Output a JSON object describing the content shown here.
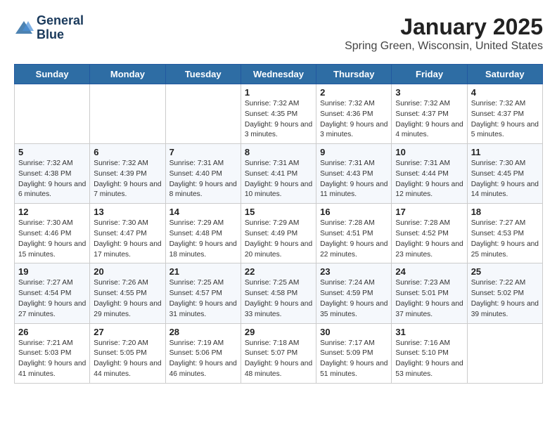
{
  "header": {
    "logo_line1": "General",
    "logo_line2": "Blue",
    "month_title": "January 2025",
    "location": "Spring Green, Wisconsin, United States"
  },
  "days_of_week": [
    "Sunday",
    "Monday",
    "Tuesday",
    "Wednesday",
    "Thursday",
    "Friday",
    "Saturday"
  ],
  "weeks": [
    [
      {
        "day": "",
        "text": ""
      },
      {
        "day": "",
        "text": ""
      },
      {
        "day": "",
        "text": ""
      },
      {
        "day": "1",
        "text": "Sunrise: 7:32 AM\nSunset: 4:35 PM\nDaylight: 9 hours and 3 minutes."
      },
      {
        "day": "2",
        "text": "Sunrise: 7:32 AM\nSunset: 4:36 PM\nDaylight: 9 hours and 3 minutes."
      },
      {
        "day": "3",
        "text": "Sunrise: 7:32 AM\nSunset: 4:37 PM\nDaylight: 9 hours and 4 minutes."
      },
      {
        "day": "4",
        "text": "Sunrise: 7:32 AM\nSunset: 4:37 PM\nDaylight: 9 hours and 5 minutes."
      }
    ],
    [
      {
        "day": "5",
        "text": "Sunrise: 7:32 AM\nSunset: 4:38 PM\nDaylight: 9 hours and 6 minutes."
      },
      {
        "day": "6",
        "text": "Sunrise: 7:32 AM\nSunset: 4:39 PM\nDaylight: 9 hours and 7 minutes."
      },
      {
        "day": "7",
        "text": "Sunrise: 7:31 AM\nSunset: 4:40 PM\nDaylight: 9 hours and 8 minutes."
      },
      {
        "day": "8",
        "text": "Sunrise: 7:31 AM\nSunset: 4:41 PM\nDaylight: 9 hours and 10 minutes."
      },
      {
        "day": "9",
        "text": "Sunrise: 7:31 AM\nSunset: 4:43 PM\nDaylight: 9 hours and 11 minutes."
      },
      {
        "day": "10",
        "text": "Sunrise: 7:31 AM\nSunset: 4:44 PM\nDaylight: 9 hours and 12 minutes."
      },
      {
        "day": "11",
        "text": "Sunrise: 7:30 AM\nSunset: 4:45 PM\nDaylight: 9 hours and 14 minutes."
      }
    ],
    [
      {
        "day": "12",
        "text": "Sunrise: 7:30 AM\nSunset: 4:46 PM\nDaylight: 9 hours and 15 minutes."
      },
      {
        "day": "13",
        "text": "Sunrise: 7:30 AM\nSunset: 4:47 PM\nDaylight: 9 hours and 17 minutes."
      },
      {
        "day": "14",
        "text": "Sunrise: 7:29 AM\nSunset: 4:48 PM\nDaylight: 9 hours and 18 minutes."
      },
      {
        "day": "15",
        "text": "Sunrise: 7:29 AM\nSunset: 4:49 PM\nDaylight: 9 hours and 20 minutes."
      },
      {
        "day": "16",
        "text": "Sunrise: 7:28 AM\nSunset: 4:51 PM\nDaylight: 9 hours and 22 minutes."
      },
      {
        "day": "17",
        "text": "Sunrise: 7:28 AM\nSunset: 4:52 PM\nDaylight: 9 hours and 23 minutes."
      },
      {
        "day": "18",
        "text": "Sunrise: 7:27 AM\nSunset: 4:53 PM\nDaylight: 9 hours and 25 minutes."
      }
    ],
    [
      {
        "day": "19",
        "text": "Sunrise: 7:27 AM\nSunset: 4:54 PM\nDaylight: 9 hours and 27 minutes."
      },
      {
        "day": "20",
        "text": "Sunrise: 7:26 AM\nSunset: 4:55 PM\nDaylight: 9 hours and 29 minutes."
      },
      {
        "day": "21",
        "text": "Sunrise: 7:25 AM\nSunset: 4:57 PM\nDaylight: 9 hours and 31 minutes."
      },
      {
        "day": "22",
        "text": "Sunrise: 7:25 AM\nSunset: 4:58 PM\nDaylight: 9 hours and 33 minutes."
      },
      {
        "day": "23",
        "text": "Sunrise: 7:24 AM\nSunset: 4:59 PM\nDaylight: 9 hours and 35 minutes."
      },
      {
        "day": "24",
        "text": "Sunrise: 7:23 AM\nSunset: 5:01 PM\nDaylight: 9 hours and 37 minutes."
      },
      {
        "day": "25",
        "text": "Sunrise: 7:22 AM\nSunset: 5:02 PM\nDaylight: 9 hours and 39 minutes."
      }
    ],
    [
      {
        "day": "26",
        "text": "Sunrise: 7:21 AM\nSunset: 5:03 PM\nDaylight: 9 hours and 41 minutes."
      },
      {
        "day": "27",
        "text": "Sunrise: 7:20 AM\nSunset: 5:05 PM\nDaylight: 9 hours and 44 minutes."
      },
      {
        "day": "28",
        "text": "Sunrise: 7:19 AM\nSunset: 5:06 PM\nDaylight: 9 hours and 46 minutes."
      },
      {
        "day": "29",
        "text": "Sunrise: 7:18 AM\nSunset: 5:07 PM\nDaylight: 9 hours and 48 minutes."
      },
      {
        "day": "30",
        "text": "Sunrise: 7:17 AM\nSunset: 5:09 PM\nDaylight: 9 hours and 51 minutes."
      },
      {
        "day": "31",
        "text": "Sunrise: 7:16 AM\nSunset: 5:10 PM\nDaylight: 9 hours and 53 minutes."
      },
      {
        "day": "",
        "text": ""
      }
    ]
  ]
}
